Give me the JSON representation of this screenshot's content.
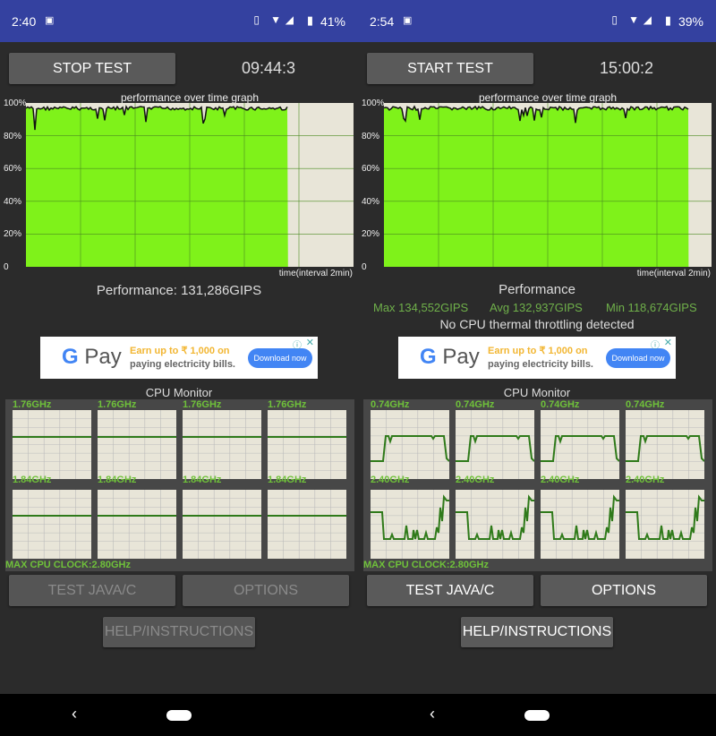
{
  "colors": {
    "status_bar": "#3441a0",
    "graph_fill": "#7ff21a",
    "cpu_line": "#2f7a1a",
    "freq_label": "#6fc13a",
    "stats": "#6fb04a"
  },
  "panels": [
    {
      "status": {
        "time": "2:40",
        "notif_icon": "image-icon",
        "battery": "41%"
      },
      "main_button": "STOP TEST",
      "timer": "09:44:3",
      "graph": {
        "title": "performance over time graph",
        "y_ticks": [
          "100%",
          "80%",
          "60%",
          "40%",
          "20%",
          "0"
        ],
        "x_label": "time(interval 2min)",
        "fill_fraction": 0.8
      },
      "performance": "Performance: 131,286GIPS",
      "ad": {
        "brand": "G Pay",
        "line1": "Earn up to ₹ 1,000 on",
        "line2": "paying electricity bills.",
        "cta": "Download now"
      },
      "cpu": {
        "title": "CPU Monitor",
        "row1": [
          "1.76GHz",
          "1.76GHz",
          "1.76GHz",
          "1.76GHz"
        ],
        "row2": [
          "1.84GHz",
          "1.84GHz",
          "1.84GHz",
          "1.84GHz"
        ],
        "max_clock": "MAX CPU CLOCK:2.80GHz"
      },
      "buttons": {
        "test": "TEST JAVA/C",
        "options": "OPTIONS",
        "help": "HELP/INSTRUCTIONS",
        "enabled": false
      }
    },
    {
      "status": {
        "time": "2:54",
        "notif_icon": "message-icon",
        "battery": "39%"
      },
      "main_button": "START TEST",
      "timer": "15:00:2",
      "graph": {
        "title": "performance over time graph",
        "y_ticks": [
          "100%",
          "80%",
          "60%",
          "40%",
          "20%",
          "0"
        ],
        "x_label": "time(interval 2min)",
        "fill_fraction": 0.93
      },
      "performance": "Performance",
      "stats": {
        "max": "Max 134,552GIPS",
        "avg": "Avg 132,937GIPS",
        "min": "Min 118,674GIPS",
        "throttle": "No CPU thermal throttling detected"
      },
      "ad": {
        "brand": "G Pay",
        "line1": "Earn up to ₹ 1,000 on",
        "line2": "paying electricity bills.",
        "cta": "Download now"
      },
      "cpu": {
        "title": "CPU Monitor",
        "row1": [
          "0.74GHz",
          "0.74GHz",
          "0.74GHz",
          "0.74GHz"
        ],
        "row2": [
          "2.40GHz",
          "2.40GHz",
          "2.40GHz",
          "2.40GHz"
        ],
        "max_clock": "MAX CPU CLOCK:2.80GHz"
      },
      "buttons": {
        "test": "TEST JAVA/C",
        "options": "OPTIONS",
        "help": "HELP/INSTRUCTIONS",
        "enabled": true
      }
    }
  ]
}
